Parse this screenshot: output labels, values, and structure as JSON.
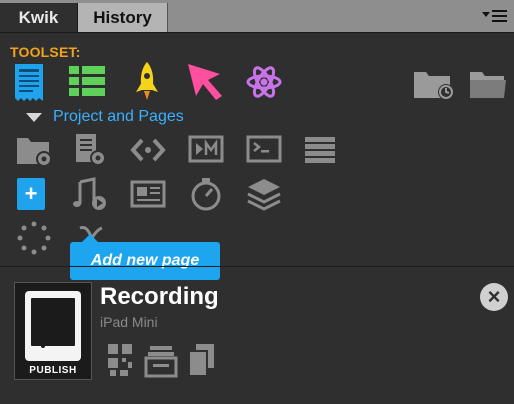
{
  "tabs": {
    "active": "Kwik",
    "inactive": "History"
  },
  "toolset": {
    "label": "TOOLSET:"
  },
  "section": {
    "label": "Project and Pages"
  },
  "tooltip": {
    "text": "Add new page"
  },
  "project": {
    "title": "Recording",
    "device": "iPad Mini",
    "publish_label": "PUBLISH"
  },
  "colors": {
    "accent_blue": "#1fa3ec",
    "toolset_orange": "#f2a31c",
    "pink": "#ff4f9e",
    "yellow": "#f5d21c",
    "purple": "#c874e8",
    "green": "#5fd05a"
  }
}
